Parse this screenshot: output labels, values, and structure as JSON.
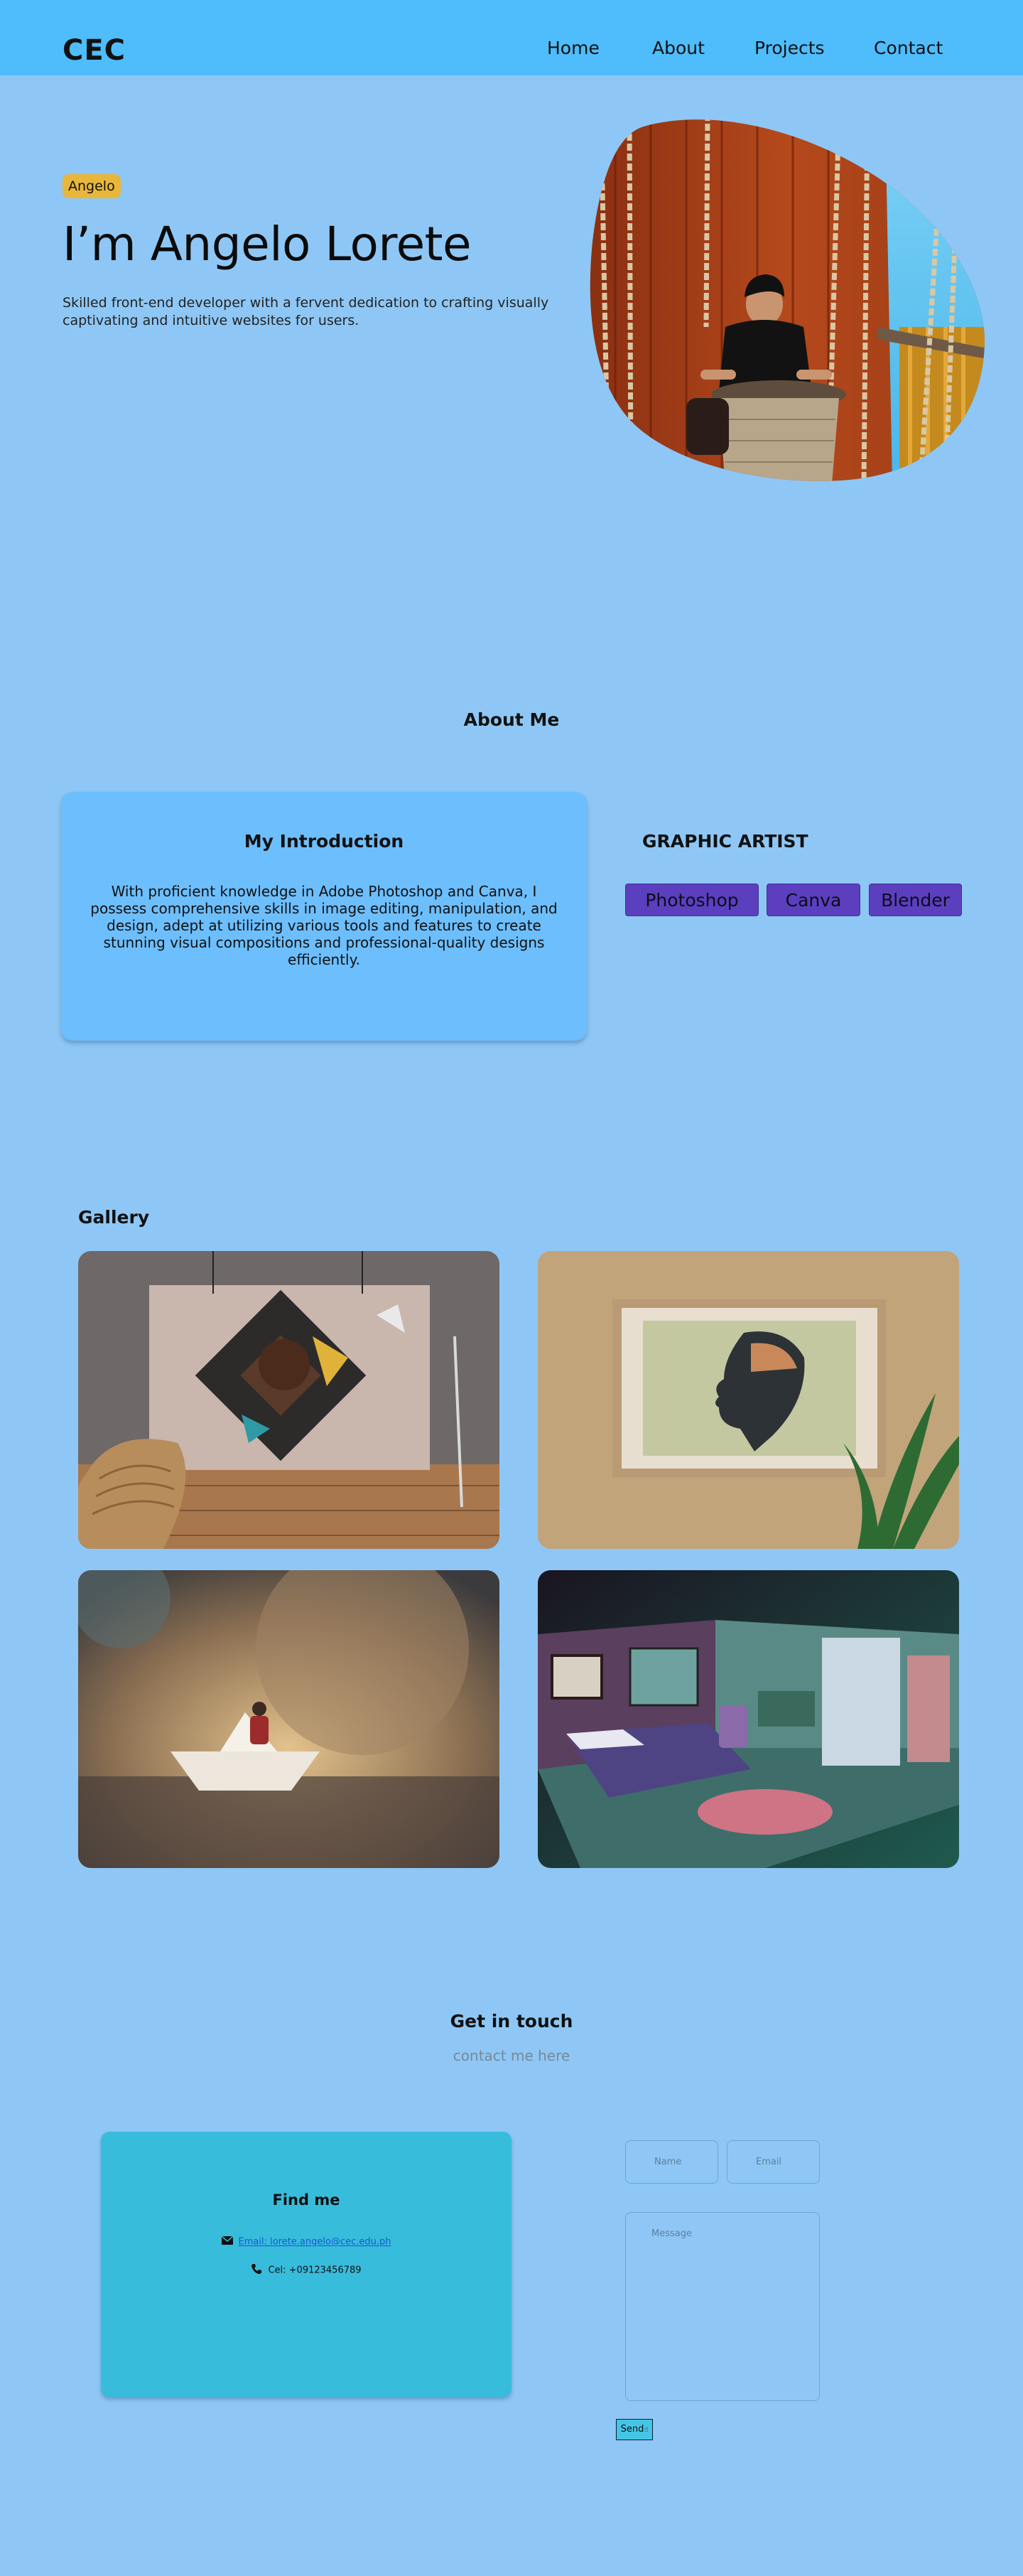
{
  "nav": {
    "logo": "CEC",
    "links": [
      "Home",
      "About",
      "Projects",
      "Contact"
    ]
  },
  "hero": {
    "badge": "Angelo",
    "title": "I’m Angelo Lorete",
    "description": "Skilled front-end developer with a fervent dedication to crafting visually captivating and intuitive websites for users."
  },
  "about": {
    "title": "About Me",
    "intro_title": "My Introduction",
    "intro_text": "With proficient knowledge in Adobe Photoshop and Canva, I possess comprehensive skills in image editing, manipulation, and design, adept at utilizing various tools and features to create stunning visual compositions and professional-quality designs efficiently.",
    "skills_heading": "GRAPHIC ARTIST",
    "skills": [
      "Photoshop",
      "Canva",
      "Blender"
    ]
  },
  "gallery": {
    "title": "Gallery"
  },
  "contact": {
    "title": "Get in touch",
    "subtitle": "contact me here",
    "find_title": "Find me",
    "email": "Email: lorete.angelo@cec.edu.ph",
    "phone": "Cel: +09123456789",
    "name_placeholder": "Name",
    "email_placeholder": "Email",
    "message_placeholder": "Message",
    "send_label": "Send"
  },
  "colors": {
    "page_bg": "#8ec7f5",
    "nav_bg": "#4fbcfb",
    "badge": "#e8b63b",
    "intro_card": "#6dbefc",
    "skill_button": "#5b3fbe",
    "find_card": "#38bcdc"
  },
  "icons": {
    "email": "envelope-icon",
    "phone": "phone-icon",
    "send": "cursor-icon"
  }
}
